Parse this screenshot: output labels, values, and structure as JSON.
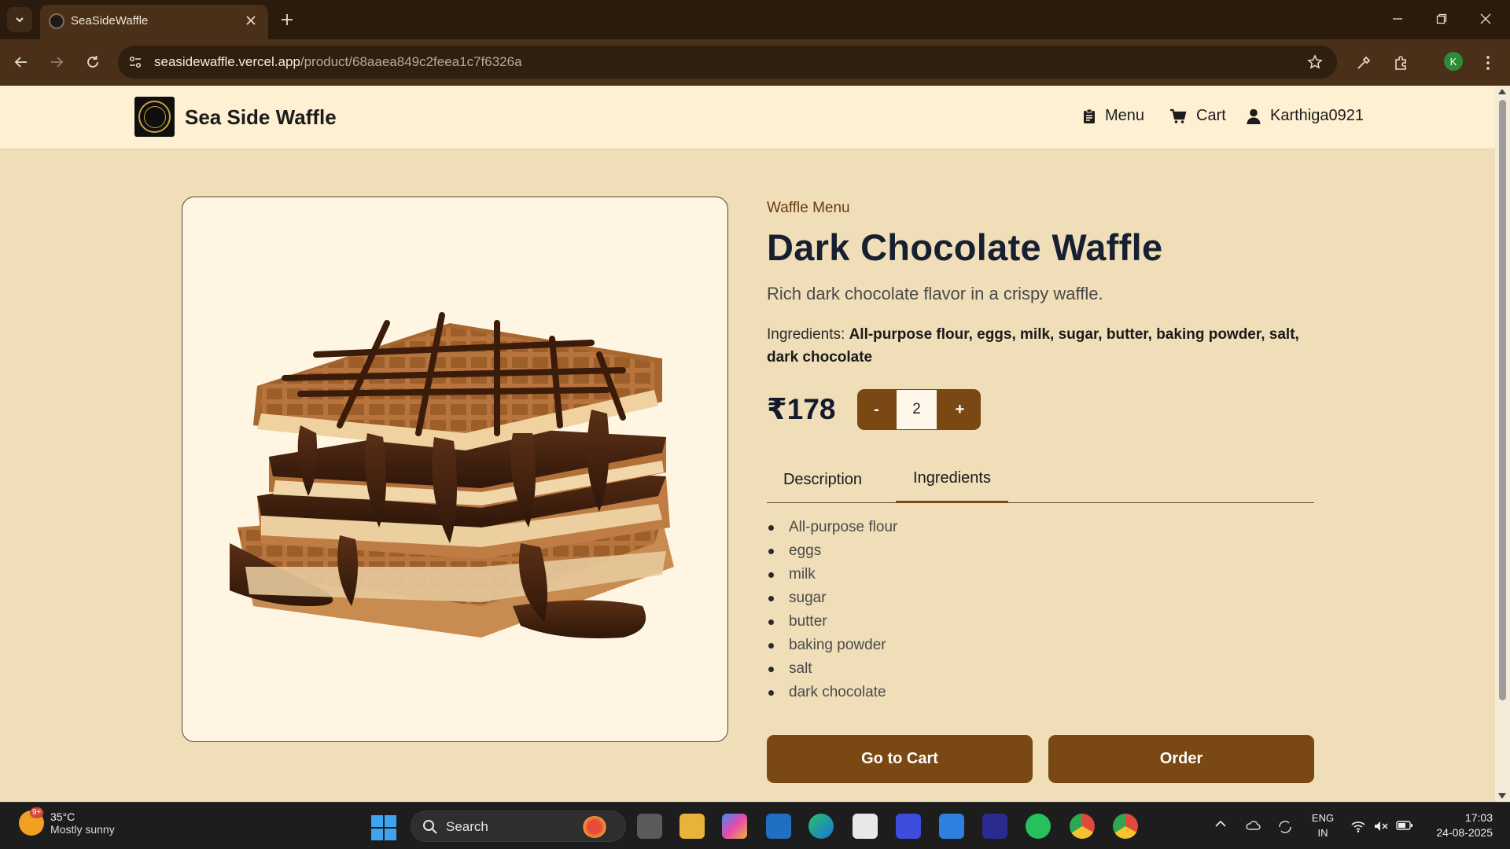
{
  "browser": {
    "tab_title": "SeaSideWaffle",
    "url_host": "seasidewaffle.vercel.app",
    "url_path": "/product/68aaea849c2feea1c7f6326a",
    "profile_initial": "K"
  },
  "header": {
    "brand": "Sea Side Waffle",
    "nav": [
      {
        "label": "Menu",
        "icon": "clipboard-icon"
      },
      {
        "label": "Cart",
        "icon": "cart-icon"
      },
      {
        "label": "Karthiga0921",
        "icon": "user-icon"
      }
    ]
  },
  "product": {
    "category": "Waffle Menu",
    "name": "Dark Chocolate Waffle",
    "description": "Rich dark chocolate flavor in a crispy waffle.",
    "ingredients_label": "Ingredients:",
    "ingredients_text": "All-purpose flour, eggs, milk, sugar, butter, baking powder, salt, dark chocolate",
    "price": "₹178",
    "quantity": "2",
    "decrement_label": "-",
    "increment_label": "+",
    "tabs": [
      {
        "label": "Description",
        "active": false
      },
      {
        "label": "Ingredients",
        "active": true
      }
    ],
    "ingredients": [
      "All-purpose flour",
      "eggs",
      "milk",
      "sugar",
      "butter",
      "baking powder",
      "salt",
      "dark chocolate"
    ],
    "go_to_cart_label": "Go to Cart",
    "order_label": "Order"
  },
  "taskbar": {
    "temperature": "35°C",
    "weather": "Mostly sunny",
    "weather_badge": "9+",
    "search_label": "Search",
    "lang_top": "ENG",
    "lang_bottom": "IN",
    "time": "17:03",
    "date": "24-08-2025"
  },
  "colors": {
    "page_bg": "#efdeb8",
    "header_bg": "#fef0d2",
    "accent_brown": "#7a4813",
    "title_navy": "#172033"
  }
}
